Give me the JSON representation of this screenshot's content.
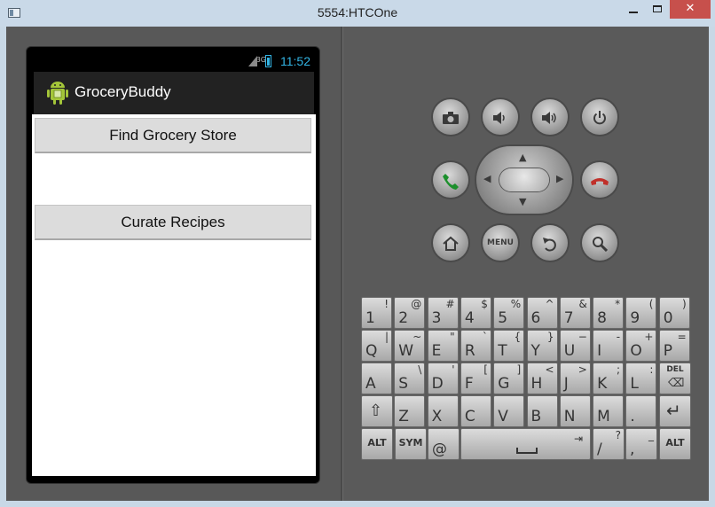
{
  "window": {
    "title": "5554:HTCOne",
    "min": "",
    "max": "",
    "close": "✕"
  },
  "device": {
    "status": {
      "network": "3G",
      "time": "11:52"
    },
    "app_title": "GroceryBuddy",
    "buttons": {
      "find": "Find Grocery Store",
      "curate": "Curate Recipes"
    }
  },
  "controls": {
    "camera_icon": "camera-icon",
    "menu_label": "MENU"
  },
  "keyboard": {
    "row1": [
      {
        "m": "1",
        "a": "!"
      },
      {
        "m": "2",
        "a": "@"
      },
      {
        "m": "3",
        "a": "#"
      },
      {
        "m": "4",
        "a": "$"
      },
      {
        "m": "5",
        "a": "%"
      },
      {
        "m": "6",
        "a": "^"
      },
      {
        "m": "7",
        "a": "&"
      },
      {
        "m": "8",
        "a": "*"
      },
      {
        "m": "9",
        "a": "("
      },
      {
        "m": "0",
        "a": ")"
      }
    ],
    "row2": [
      {
        "m": "Q",
        "a": "|"
      },
      {
        "m": "W",
        "a": "~"
      },
      {
        "m": "E",
        "a": "\""
      },
      {
        "m": "R",
        "a": "`"
      },
      {
        "m": "T",
        "a": "{"
      },
      {
        "m": "Y",
        "a": "}"
      },
      {
        "m": "U",
        "a": "−"
      },
      {
        "m": "I",
        "a": "-"
      },
      {
        "m": "O",
        "a": "+"
      },
      {
        "m": "P",
        "a": "="
      }
    ],
    "row3": [
      {
        "m": "A",
        "a": ""
      },
      {
        "m": "S",
        "a": "\\"
      },
      {
        "m": "D",
        "a": "'"
      },
      {
        "m": "F",
        "a": "["
      },
      {
        "m": "G",
        "a": "]"
      },
      {
        "m": "H",
        "a": "<"
      },
      {
        "m": "J",
        "a": ">"
      },
      {
        "m": "K",
        "a": ";"
      },
      {
        "m": "L",
        "a": ":"
      }
    ],
    "del": "DEL",
    "row4": [
      {
        "m": "Z",
        "a": ""
      },
      {
        "m": "X",
        "a": ""
      },
      {
        "m": "C",
        "a": ""
      },
      {
        "m": "V",
        "a": ""
      },
      {
        "m": "B",
        "a": ""
      },
      {
        "m": "N",
        "a": ""
      },
      {
        "m": "M",
        "a": ""
      },
      {
        "m": ".",
        "a": ""
      }
    ],
    "alt": "ALT",
    "sym": "SYM",
    "at": "@",
    "slash": {
      "m": "/",
      "a": "?"
    },
    "comma": {
      "m": ",",
      "a": "_"
    }
  },
  "colors": {
    "accent": "#33b5e5",
    "close": "#c7504c",
    "call_green": "#1c8f2c",
    "end_red": "#c0302a"
  }
}
